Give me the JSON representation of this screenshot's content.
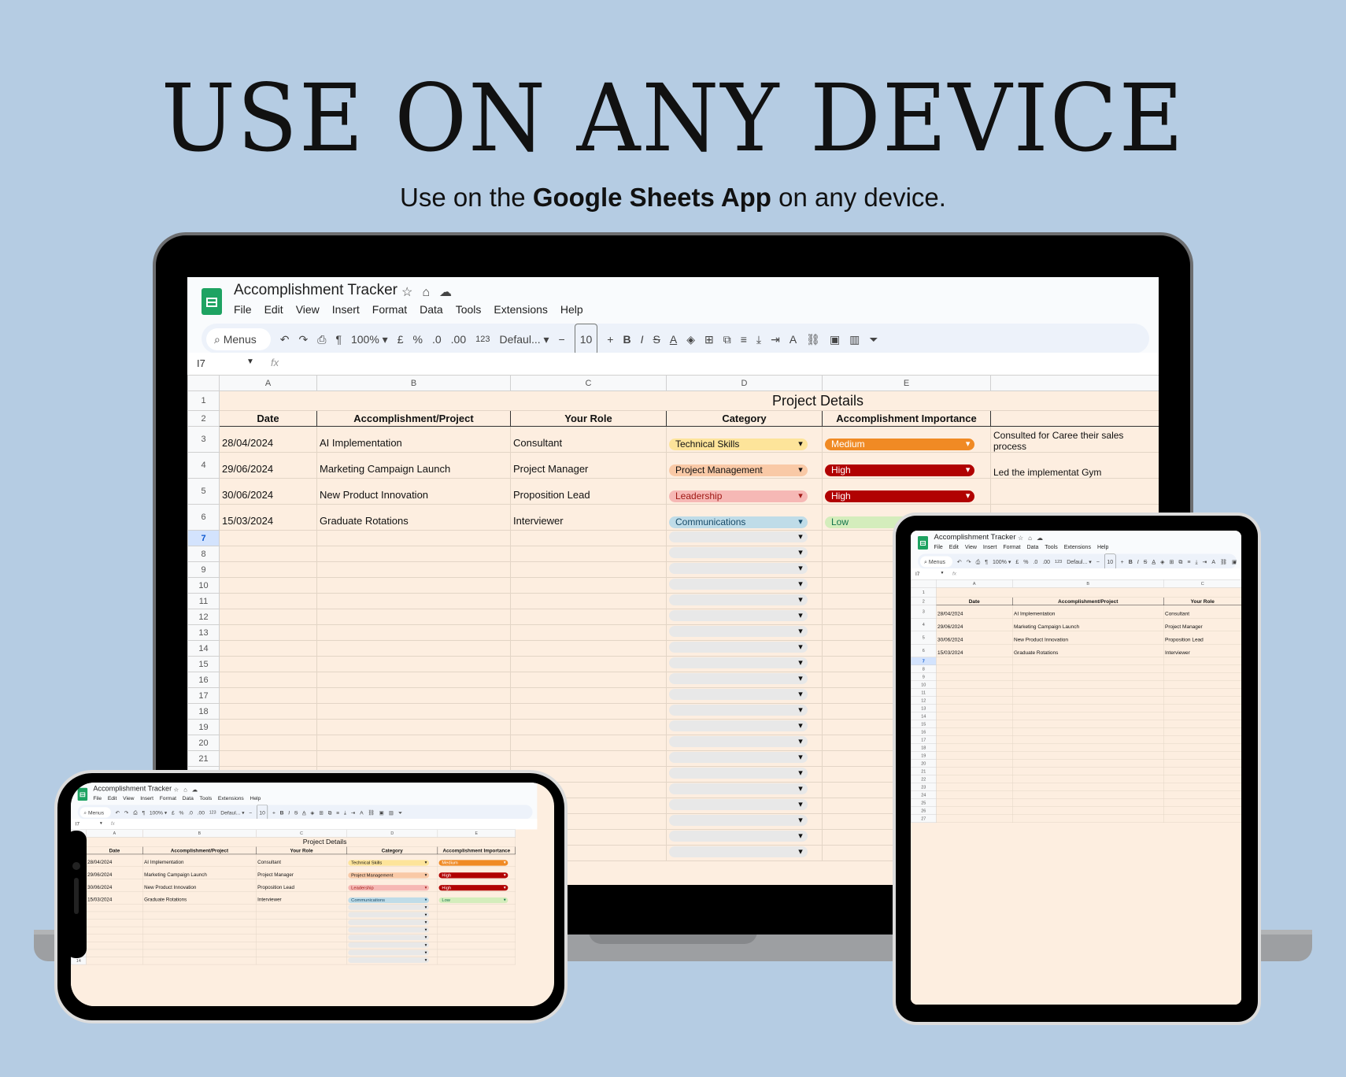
{
  "headline": "USE ON ANY DEVICE",
  "subline": {
    "prefix": "Use on the ",
    "bold": "Google Sheets App",
    "suffix": " on any device."
  },
  "app": {
    "doc_title": "Accomplishment Tracker",
    "menu": [
      "File",
      "Edit",
      "View",
      "Insert",
      "Format",
      "Data",
      "Tools",
      "Extensions",
      "Help"
    ],
    "toolbar": {
      "menus_label": "Menus",
      "zoom": "100%",
      "currency": "£",
      "percent": "%",
      "dec_dec": ".0",
      "dec_inc": ".00",
      "number_format": "123",
      "font": "Defaul...",
      "font_size": "10"
    },
    "name_box": "I7",
    "fx": "fx"
  },
  "sheet": {
    "columns": [
      "A",
      "B",
      "C",
      "D",
      "E"
    ],
    "section_title": "Project Details",
    "headers": [
      "Date",
      "Accomplishment/Project",
      "Your Role",
      "Category",
      "Accomplishment Importance"
    ],
    "rows": [
      {
        "date": "28/04/2024",
        "project": "AI Implementation",
        "role": "Consultant",
        "category": "Technical Skills",
        "importance": "Medium",
        "notes": "Consulted for Caree their sales process"
      },
      {
        "date": "29/06/2024",
        "project": "Marketing Campaign Launch",
        "role": "Project Manager",
        "category": "Project Management",
        "importance": "High",
        "notes": "Led the implementat Gym"
      },
      {
        "date": "30/06/2024",
        "project": "New Product Innovation",
        "role": "Proposition Lead",
        "category": "Leadership",
        "importance": "High",
        "notes": ""
      },
      {
        "date": "15/03/2024",
        "project": "Graduate Rotations",
        "role": "Interviewer",
        "category": "Communications",
        "importance": "Low",
        "notes": ""
      }
    ],
    "row_numbers": [
      "1",
      "2",
      "3",
      "4",
      "5",
      "6",
      "7",
      "8",
      "9",
      "10",
      "11",
      "12",
      "13",
      "14",
      "15",
      "16",
      "17",
      "18",
      "19",
      "20",
      "21",
      "22",
      "23",
      "24",
      "25",
      "26",
      "27"
    ],
    "selected_row": "7",
    "colors": {
      "sheet_bg": "#fdeee0",
      "page_bg": "#b5cce3",
      "technical": "#fde49a",
      "pm": "#f9c9a6",
      "leadership": "#f6b8b5",
      "communications": "#bfdce8",
      "medium": "#f08a24",
      "high": "#b10202",
      "low": "#d4edbc"
    }
  }
}
